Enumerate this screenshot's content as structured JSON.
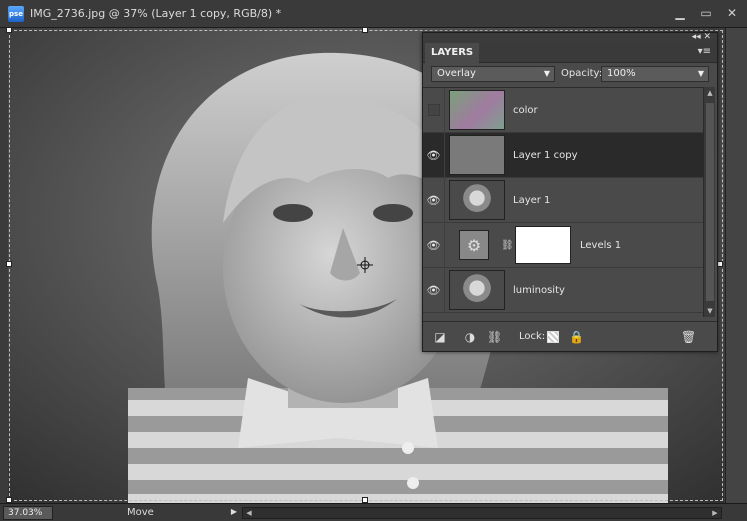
{
  "window": {
    "app_icon_text": "pse",
    "title": "IMG_2736.jpg @ 37% (Layer 1 copy, RGB/8) *"
  },
  "layers_panel": {
    "tab_label": "LAYERS",
    "blend_mode": "Overlay",
    "opacity_label": "Opacity:",
    "opacity_value": "100%",
    "layers": [
      {
        "name": "color",
        "visible": false,
        "thumb": "color"
      },
      {
        "name": "Layer 1 copy",
        "visible": true,
        "selected": true,
        "thumb": "gray"
      },
      {
        "name": "Layer 1",
        "visible": true,
        "thumb": "photo"
      },
      {
        "name": "Levels 1",
        "visible": true,
        "thumb": "adjustment"
      },
      {
        "name": "luminosity",
        "visible": true,
        "thumb": "photo"
      }
    ],
    "lock_label": "Lock:"
  },
  "statusbar": {
    "zoom": "37.03%",
    "tool": "Move"
  },
  "colors": {
    "panel_bg": "#4a4a4a",
    "selected_row": "#2a2a2a",
    "titlebar": "#3a3a3a"
  }
}
